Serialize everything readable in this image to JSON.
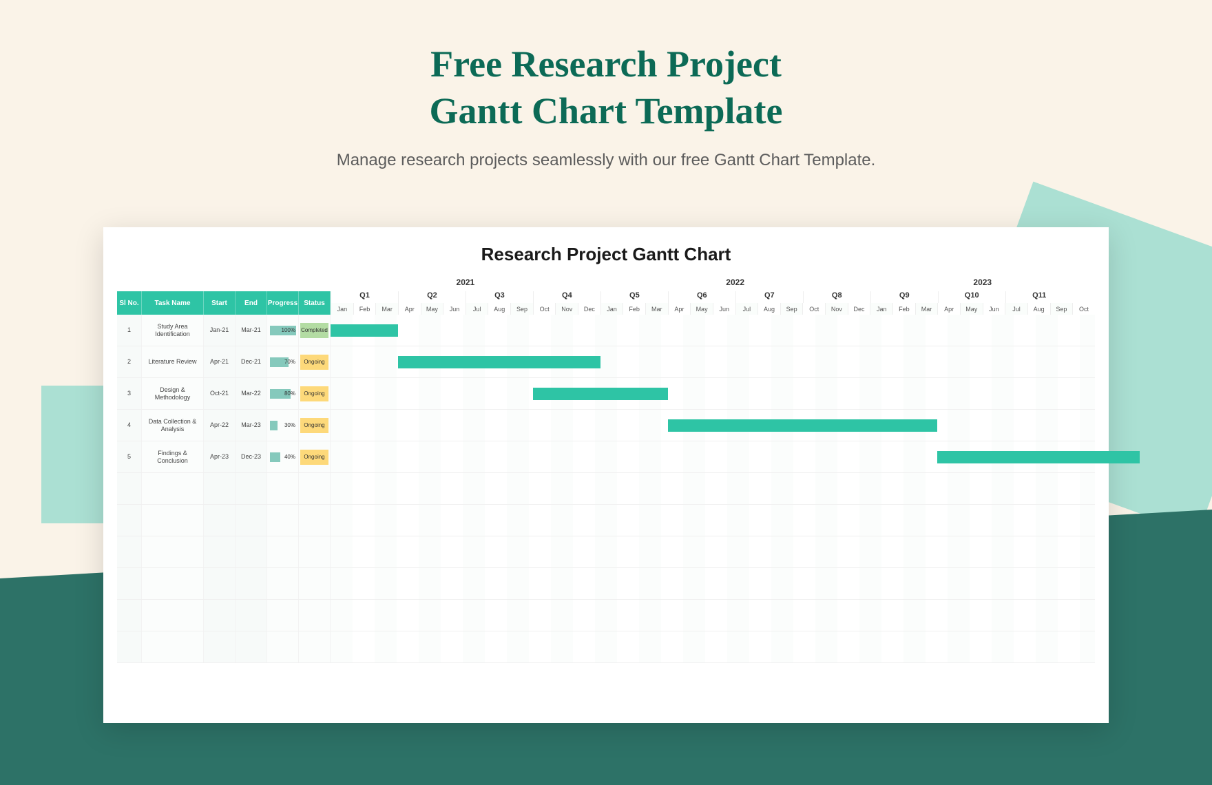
{
  "page": {
    "title_line1": "Free Research Project",
    "title_line2": "Gantt Chart Template",
    "subtitle": "Manage research projects seamlessly with our free Gantt Chart Template."
  },
  "chart": {
    "title": "Research Project Gantt Chart",
    "columns": {
      "sl": "Sl No.",
      "task": "Task Name",
      "start": "Start",
      "end": "End",
      "progress": "Progress",
      "status": "Status"
    },
    "years": [
      "2021",
      "2022",
      "2023"
    ],
    "quarters": [
      "Q1",
      "Q2",
      "Q3",
      "Q4",
      "Q5",
      "Q6",
      "Q7",
      "Q8",
      "Q9",
      "Q10",
      "Q11"
    ],
    "months": [
      "Jan",
      "Feb",
      "Mar",
      "Apr",
      "May",
      "Jun",
      "Jul",
      "Aug",
      "Sep",
      "Oct",
      "Nov",
      "Dec",
      "Jan",
      "Feb",
      "Mar",
      "Apr",
      "May",
      "Jun",
      "Jul",
      "Aug",
      "Sep",
      "Oct",
      "Nov",
      "Dec",
      "Jan",
      "Feb",
      "Mar",
      "Apr",
      "May",
      "Jun",
      "Jul",
      "Aug",
      "Sep",
      "Oct"
    ],
    "tasks": [
      {
        "sl": "1",
        "name": "Study Area Identification",
        "start": "Jan-21",
        "end": "Mar-21",
        "progress": "100%",
        "progress_pct": 100,
        "status": "Completed",
        "bar_start": 0,
        "bar_span": 3
      },
      {
        "sl": "2",
        "name": "Literature Review",
        "start": "Apr-21",
        "end": "Dec-21",
        "progress": "70%",
        "progress_pct": 70,
        "status": "Ongoing",
        "bar_start": 3,
        "bar_span": 9
      },
      {
        "sl": "3",
        "name": "Design & Methodology",
        "start": "Oct-21",
        "end": "Mar-22",
        "progress": "80%",
        "progress_pct": 80,
        "status": "Ongoing",
        "bar_start": 9,
        "bar_span": 6
      },
      {
        "sl": "4",
        "name": "Data Collection & Analysis",
        "start": "Apr-22",
        "end": "Mar-23",
        "progress": "30%",
        "progress_pct": 30,
        "status": "Ongoing",
        "bar_start": 15,
        "bar_span": 12
      },
      {
        "sl": "5",
        "name": "Findings & Conclusion",
        "start": "Apr-23",
        "end": "Dec-23",
        "progress": "40%",
        "progress_pct": 40,
        "status": "Ongoing",
        "bar_start": 27,
        "bar_span": 9
      }
    ],
    "total_months": 34
  },
  "colors": {
    "brand_dark": "#0c6a56",
    "teal_bg": "#2d7267",
    "mint": "#abe0d3",
    "bar": "#2ec4a5",
    "progress": "#85c9bc",
    "ongoing": "#fdd97a",
    "completed": "#b3dca3",
    "cream": "#faf3e8"
  },
  "chart_data": {
    "type": "gantt",
    "title": "Research Project Gantt Chart",
    "x_axis": {
      "unit": "month",
      "start": "2021-01",
      "end": "2023-10",
      "years": [
        "2021",
        "2022",
        "2023"
      ],
      "quarters": [
        "Q1",
        "Q2",
        "Q3",
        "Q4",
        "Q5",
        "Q6",
        "Q7",
        "Q8",
        "Q9",
        "Q10",
        "Q11"
      ]
    },
    "series": [
      {
        "id": 1,
        "name": "Study Area Identification",
        "start": "2021-01",
        "end": "2021-03",
        "progress_pct": 100,
        "status": "Completed"
      },
      {
        "id": 2,
        "name": "Literature Review",
        "start": "2021-04",
        "end": "2021-12",
        "progress_pct": 70,
        "status": "Ongoing"
      },
      {
        "id": 3,
        "name": "Design & Methodology",
        "start": "2021-10",
        "end": "2022-03",
        "progress_pct": 80,
        "status": "Ongoing"
      },
      {
        "id": 4,
        "name": "Data Collection & Analysis",
        "start": "2022-04",
        "end": "2023-03",
        "progress_pct": 30,
        "status": "Ongoing"
      },
      {
        "id": 5,
        "name": "Findings & Conclusion",
        "start": "2023-04",
        "end": "2023-12",
        "progress_pct": 40,
        "status": "Ongoing"
      }
    ]
  }
}
